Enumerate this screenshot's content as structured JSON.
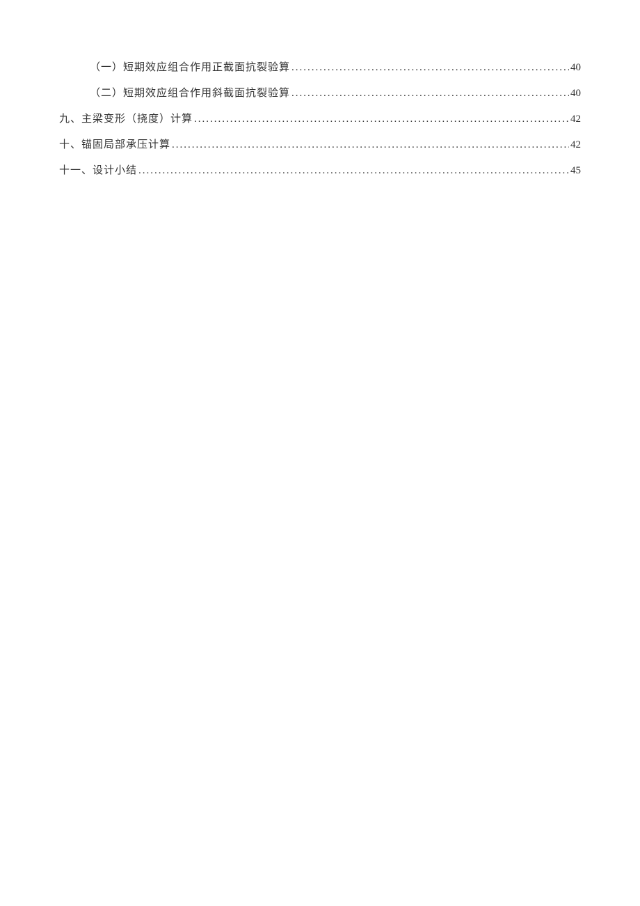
{
  "toc": {
    "entries": [
      {
        "level": 2,
        "title": "（一）短期效应组合作用正截面抗裂验算",
        "page": "40"
      },
      {
        "level": 2,
        "title": "（二）短期效应组合作用斜截面抗裂验算",
        "page": "40"
      },
      {
        "level": 1,
        "title": "九、主梁变形（挠度）计算",
        "page": "42"
      },
      {
        "level": 1,
        "title": "十、锚固局部承压计算",
        "page": "42"
      },
      {
        "level": 1,
        "title": "十一、设计小结",
        "page": "45"
      }
    ]
  }
}
